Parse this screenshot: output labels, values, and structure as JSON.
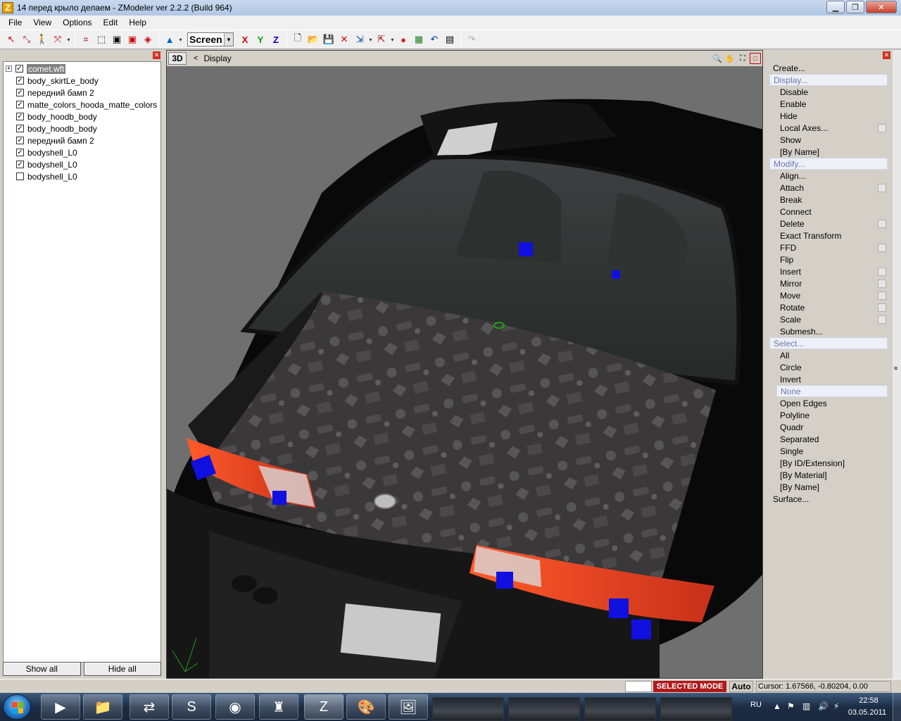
{
  "window": {
    "title": "14 перед крыло делаем - ZModeler ver 2.2.2 (Build 964)",
    "icon_letter": "Z"
  },
  "menu": [
    "File",
    "View",
    "Options",
    "Edit",
    "Help"
  ],
  "toolbar": {
    "coord_system": "Screen",
    "axis_x": "X",
    "axis_y": "Y",
    "axis_z": "Z"
  },
  "scene_tree": {
    "items": [
      {
        "name": "comet.wft",
        "checked": true,
        "root": true,
        "selected": true
      },
      {
        "name": "body_skirtLe_body",
        "checked": true
      },
      {
        "name": "передний бамп 2",
        "checked": true
      },
      {
        "name": "matte_colors_hooda_matte_colors",
        "checked": true
      },
      {
        "name": "body_hoodb_body",
        "checked": true
      },
      {
        "name": "body_hoodb_body",
        "checked": true
      },
      {
        "name": "передний бамп 2",
        "checked": true
      },
      {
        "name": "bodyshell_L0",
        "checked": true
      },
      {
        "name": "bodyshell_L0",
        "checked": true
      },
      {
        "name": "bodyshell_L0",
        "checked": false
      }
    ],
    "show_all_label": "Show all",
    "hide_all_label": "Hide all"
  },
  "viewport": {
    "mode_label": "3D",
    "back_label": "<",
    "breadcrumb": "Display"
  },
  "commands": [
    {
      "label": "Create...",
      "type": "group"
    },
    {
      "label": "Display...",
      "type": "group",
      "highlight": true
    },
    {
      "label": "Disable",
      "type": "item"
    },
    {
      "label": "Enable",
      "type": "item"
    },
    {
      "label": "Hide",
      "type": "item"
    },
    {
      "label": "Local Axes...",
      "type": "item",
      "option": true
    },
    {
      "label": "Show",
      "type": "item"
    },
    {
      "label": "[By Name]",
      "type": "item"
    },
    {
      "label": "Modify...",
      "type": "group",
      "highlight": true
    },
    {
      "label": "Align...",
      "type": "item"
    },
    {
      "label": "Attach",
      "type": "item",
      "option": true
    },
    {
      "label": "Break",
      "type": "item"
    },
    {
      "label": "Connect",
      "type": "item"
    },
    {
      "label": "Delete",
      "type": "item",
      "option": true
    },
    {
      "label": "Exact Transform",
      "type": "item"
    },
    {
      "label": "FFD",
      "type": "item",
      "option": true
    },
    {
      "label": "Flip",
      "type": "item"
    },
    {
      "label": "Insert",
      "type": "item",
      "option": true
    },
    {
      "label": "Mirror",
      "type": "item",
      "option": true
    },
    {
      "label": "Move",
      "type": "item",
      "option": true
    },
    {
      "label": "Rotate",
      "type": "item",
      "option": true
    },
    {
      "label": "Scale",
      "type": "item",
      "option": true
    },
    {
      "label": "Submesh...",
      "type": "item"
    },
    {
      "label": "Select...",
      "type": "group",
      "highlight": true
    },
    {
      "label": "All",
      "type": "item"
    },
    {
      "label": "Circle",
      "type": "item"
    },
    {
      "label": "Invert",
      "type": "item"
    },
    {
      "label": "None",
      "type": "item",
      "highlight": true
    },
    {
      "label": "Open Edges",
      "type": "item"
    },
    {
      "label": "Polyline",
      "type": "item"
    },
    {
      "label": "Quadr",
      "type": "item"
    },
    {
      "label": "Separated",
      "type": "item"
    },
    {
      "label": "Single",
      "type": "item"
    },
    {
      "label": "[By ID/Extension]",
      "type": "item"
    },
    {
      "label": "[By Material]",
      "type": "item"
    },
    {
      "label": "[By Name]",
      "type": "item"
    },
    {
      "label": "Surface...",
      "type": "group"
    }
  ],
  "status": {
    "mode": "SELECTED MODE",
    "auto": "Auto",
    "cursor": "Cursor: 1.67566, -0.80204, 0.00"
  },
  "taskbar": {
    "apps": [
      "media-player",
      "file-explorer",
      "teamviewer",
      "skype",
      "firefox",
      "app-green",
      "zmodeler",
      "paint",
      "photo-viewer"
    ],
    "lang": "RU",
    "time": "22:58",
    "date": "03.05.2011"
  },
  "colors": {
    "selection_marker": "#1010e0",
    "mode_badge": "#b01818",
    "viewport_bg": "#6f6f6f"
  }
}
